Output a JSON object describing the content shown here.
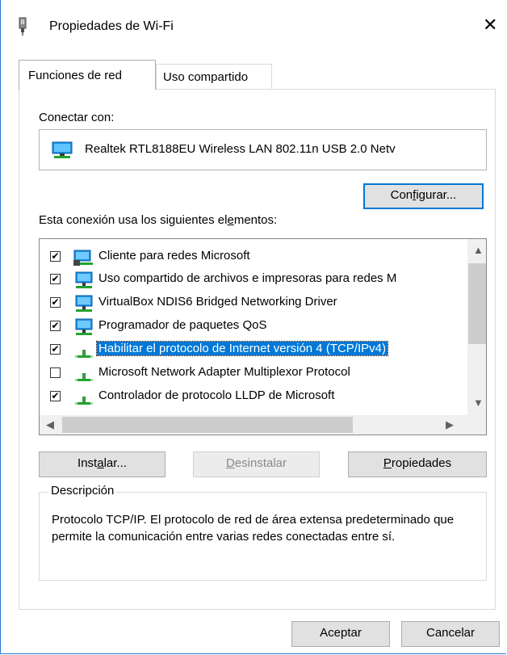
{
  "window": {
    "title": "Propiedades de Wi-Fi",
    "close_glyph": "✕",
    "icon": "network-adapter-icon"
  },
  "tabs": [
    {
      "label": "Funciones de red",
      "active": true
    },
    {
      "label": "Uso compartido",
      "active": false
    }
  ],
  "connect": {
    "label": "Conectar con:",
    "adapter_name": "Realtek RTL8188EU Wireless LAN 802.11n USB 2.0 Netv",
    "configure_button": {
      "pre": "Con",
      "accel": "f",
      "post": "igurar..."
    }
  },
  "elements": {
    "label_pre": "Esta conexión usa los siguientes el",
    "label_accel": "e",
    "label_post": "mentos:",
    "items": [
      {
        "label": "Cliente para redes Microsoft",
        "checked": true,
        "icon": "network-client-icon",
        "selected": false
      },
      {
        "label": "Uso compartido de archivos e impresoras para redes M",
        "checked": true,
        "icon": "network-service-icon",
        "selected": false
      },
      {
        "label": "VirtualBox NDIS6 Bridged Networking Driver",
        "checked": true,
        "icon": "network-service-icon",
        "selected": false
      },
      {
        "label": "Programador de paquetes QoS",
        "checked": true,
        "icon": "network-service-icon",
        "selected": false
      },
      {
        "label": "Habilitar el protocolo de Internet versión 4 (TCP/IPv4)",
        "checked": true,
        "icon": "protocol-icon",
        "selected": true
      },
      {
        "label": "Microsoft Network Adapter Multiplexor Protocol",
        "checked": false,
        "icon": "protocol-icon",
        "selected": false
      },
      {
        "label": "Controlador de protocolo LLDP de Microsoft",
        "checked": true,
        "icon": "protocol-icon",
        "selected": false
      }
    ]
  },
  "buttons": {
    "install": {
      "pre": "Inst",
      "accel": "a",
      "post": "lar..."
    },
    "uninstall": {
      "pre": "",
      "accel": "D",
      "post": "esinstalar",
      "enabled": false
    },
    "properties": {
      "pre": "",
      "accel": "P",
      "post": "ropiedades"
    },
    "ok": "Aceptar",
    "cancel": "Cancelar"
  },
  "description": {
    "title": "Descripción",
    "text": "Protocolo TCP/IP. El protocolo de red de área extensa predeterminado que permite la comunicación entre varias redes conectadas entre sí."
  },
  "colors": {
    "accent": "#0078d7",
    "button_face": "#e1e1e1",
    "window_border": "#2b79d6"
  }
}
